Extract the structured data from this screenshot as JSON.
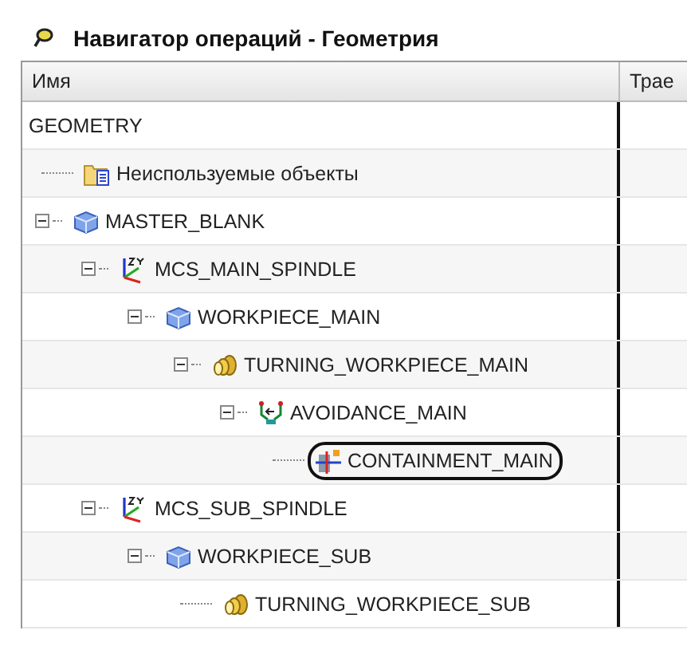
{
  "window": {
    "title": "Навигатор операций - Геометрия"
  },
  "table": {
    "columns": [
      "Имя",
      "Трае"
    ],
    "root": {
      "name": "GEOMETRY",
      "children": [
        {
          "name": "Неиспользуемые объекты",
          "kind": "folder",
          "highlighted": false
        },
        {
          "name": "MASTER_BLANK",
          "kind": "cube",
          "expanded": true,
          "highlighted": false,
          "children": [
            {
              "name": "MCS_MAIN_SPINDLE",
              "kind": "axes",
              "expanded": true,
              "highlighted": false,
              "children": [
                {
                  "name": "WORKPIECE_MAIN",
                  "kind": "cube",
                  "expanded": true,
                  "highlighted": false,
                  "children": [
                    {
                      "name": "TURNING_WORKPIECE_MAIN",
                      "kind": "turning",
                      "expanded": true,
                      "highlighted": false,
                      "children": [
                        {
                          "name": "AVOIDANCE_MAIN",
                          "kind": "avoidance",
                          "expanded": true,
                          "highlighted": false,
                          "children": [
                            {
                              "name": "CONTAINMENT_MAIN",
                              "kind": "containment",
                              "highlighted": true
                            }
                          ]
                        }
                      ]
                    }
                  ]
                }
              ]
            },
            {
              "name": "MCS_SUB_SPINDLE",
              "kind": "axes",
              "expanded": true,
              "highlighted": false,
              "children": [
                {
                  "name": "WORKPIECE_SUB",
                  "kind": "cube",
                  "expanded": true,
                  "highlighted": false,
                  "children": [
                    {
                      "name": "TURNING_WORKPIECE_SUB",
                      "kind": "turning",
                      "highlighted": false
                    }
                  ]
                }
              ]
            }
          ]
        }
      ]
    }
  }
}
